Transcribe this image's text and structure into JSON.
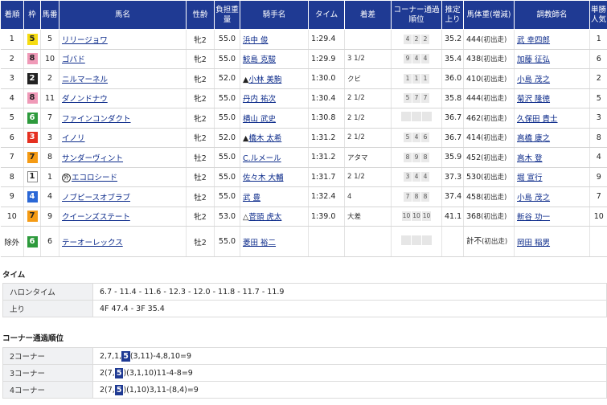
{
  "headers": [
    "着順",
    "枠",
    "馬番",
    "馬名",
    "性齢",
    "負担重量",
    "騎手名",
    "タイム",
    "着差",
    "コーナー通過順位",
    "推定上り",
    "馬体重(増減)",
    "調教師名",
    "単勝人気"
  ],
  "rows": [
    {
      "rank": "1",
      "waku": "5",
      "num": "5",
      "horse": "リリージョワ",
      "sexage": "牝2",
      "weight": "55.0",
      "jockey": "浜中 俊",
      "jmark": "",
      "time": "1:29.4",
      "margin": "",
      "corners": [
        "4",
        "2",
        "2"
      ],
      "last3f": "35.2",
      "bw": "444",
      "bwnote": "(初出走)",
      "trainer": "武 幸四郎",
      "pop": "1"
    },
    {
      "rank": "2",
      "waku": "8",
      "num": "10",
      "horse": "ゴバド",
      "sexage": "牝2",
      "weight": "55.0",
      "jockey": "鮫島 克駿",
      "jmark": "",
      "time": "1:29.9",
      "margin": "3 1/2",
      "corners": [
        "9",
        "4",
        "4"
      ],
      "last3f": "35.4",
      "bw": "438",
      "bwnote": "(初出走)",
      "trainer": "加藤 征弘",
      "pop": "6"
    },
    {
      "rank": "3",
      "waku": "2",
      "num": "2",
      "horse": "ニルマーネル",
      "sexage": "牝2",
      "weight": "52.0",
      "jockey": "小林 美駒",
      "jmark": "▲",
      "time": "1:30.0",
      "margin": "クビ",
      "corners": [
        "1",
        "1",
        "1"
      ],
      "last3f": "36.0",
      "bw": "410",
      "bwnote": "(初出走)",
      "trainer": "小島 茂之",
      "pop": "2"
    },
    {
      "rank": "4",
      "waku": "8",
      "num": "11",
      "horse": "ダノンドナウ",
      "sexage": "牝2",
      "weight": "55.0",
      "jockey": "丹内 祐次",
      "jmark": "",
      "time": "1:30.4",
      "margin": "2 1/2",
      "corners": [
        "5",
        "7",
        "7"
      ],
      "last3f": "35.8",
      "bw": "444",
      "bwnote": "(初出走)",
      "trainer": "菊沢 隆徳",
      "pop": "5"
    },
    {
      "rank": "5",
      "waku": "6",
      "num": "7",
      "horse": "ファインコンダクト",
      "sexage": "牝2",
      "weight": "55.0",
      "jockey": "横山 武史",
      "jmark": "",
      "time": "1:30.8",
      "margin": "2 1/2",
      "corners": [
        "",
        "",
        ""
      ],
      "last3f": "36.7",
      "bw": "462",
      "bwnote": "(初出走)",
      "trainer": "久保田 貴士",
      "pop": "3"
    },
    {
      "rank": "6",
      "waku": "3",
      "num": "3",
      "horse": "イノリ",
      "sexage": "牝2",
      "weight": "52.0",
      "jockey": "橋木 太希",
      "jmark": "▲",
      "time": "1:31.2",
      "margin": "2 1/2",
      "corners": [
        "5",
        "4",
        "6"
      ],
      "last3f": "36.7",
      "bw": "414",
      "bwnote": "(初出走)",
      "trainer": "高橋 康之",
      "pop": "8"
    },
    {
      "rank": "7",
      "waku": "7",
      "num": "8",
      "horse": "サンダーヴィント",
      "sexage": "牡2",
      "weight": "55.0",
      "jockey": "C.ルメール",
      "jmark": "",
      "time": "1:31.2",
      "margin": "アタマ",
      "corners": [
        "8",
        "9",
        "8"
      ],
      "last3f": "35.9",
      "bw": "452",
      "bwnote": "(初出走)",
      "trainer": "高木 登",
      "pop": "4"
    },
    {
      "rank": "8",
      "waku": "1",
      "num": "1",
      "horse": "エコロシード",
      "hmark": "外",
      "sexage": "牡2",
      "weight": "55.0",
      "jockey": "佐々木 大輔",
      "jmark": "",
      "time": "1:31.7",
      "margin": "2 1/2",
      "corners": [
        "3",
        "4",
        "4"
      ],
      "last3f": "37.3",
      "bw": "530",
      "bwnote": "(初出走)",
      "trainer": "堀 宣行",
      "pop": "9"
    },
    {
      "rank": "9",
      "waku": "4",
      "num": "4",
      "horse": "ノブピースオブラブ",
      "sexage": "牡2",
      "weight": "55.0",
      "jockey": "武 豊",
      "jmark": "",
      "time": "1:32.4",
      "margin": "4",
      "corners": [
        "7",
        "8",
        "8"
      ],
      "last3f": "37.4",
      "bw": "458",
      "bwnote": "(初出走)",
      "trainer": "小島 茂之",
      "pop": "7"
    },
    {
      "rank": "10",
      "waku": "7",
      "num": "9",
      "horse": "クイーンズステート",
      "sexage": "牝2",
      "weight": "53.0",
      "jockey": "菅頭 虎太",
      "jmark": "△",
      "time": "1:39.0",
      "margin": "大差",
      "corners": [
        "10",
        "10",
        "10"
      ],
      "last3f": "41.1",
      "bw": "368",
      "bwnote": "(初出走)",
      "trainer": "新谷 功一",
      "pop": "10"
    },
    {
      "rank": "除外",
      "waku": "6",
      "num": "6",
      "horse": "テーオーレックス",
      "sexage": "牡2",
      "weight": "55.0",
      "jockey": "菱田 裕二",
      "jmark": "",
      "time": "",
      "margin": "",
      "corners": [
        "",
        "",
        ""
      ],
      "last3f": "",
      "bw": "計不",
      "bwnote": "(初出走)",
      "trainer": "岡田 稲男",
      "pop": ""
    }
  ],
  "time_section": {
    "title": "タイム",
    "rows": [
      {
        "label": "ハロンタイム",
        "value": "6.7 - 11.4 - 11.6 - 12.3 - 12.0 - 11.8 - 11.7 - 11.9"
      },
      {
        "label": "上り",
        "value": "4F 47.4 - 3F 35.4"
      }
    ]
  },
  "corner_section": {
    "title": "コーナー通過順位",
    "rows": [
      {
        "label": "2コーナー",
        "pre": "2,7,1,",
        "hl": "5",
        "post": "(3,11)-4,8,10=9"
      },
      {
        "label": "3コーナー",
        "pre": "2(7,",
        "hl": "5",
        "post": ")(3,1,10)11-4-8=9"
      },
      {
        "label": "4コーナー",
        "pre": "2(7,",
        "hl": "5",
        "post": ")(1,10)3,11-(8,4)=9"
      }
    ]
  }
}
